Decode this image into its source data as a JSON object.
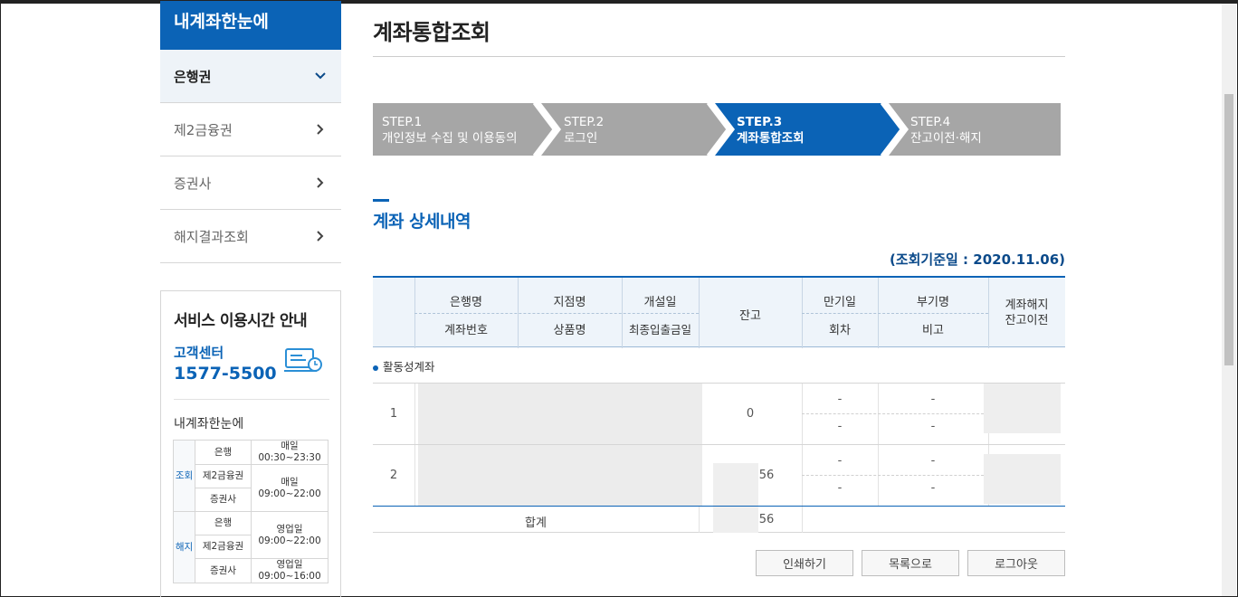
{
  "sidebar": {
    "header": "내계좌한눈에",
    "items": [
      {
        "label": "은행권"
      },
      {
        "label": "제2금융권"
      },
      {
        "label": "증권사"
      },
      {
        "label": "해지결과조회"
      }
    ]
  },
  "service": {
    "title": "서비스 이용시간 안내",
    "center_label": "고객센터",
    "center_number": "1577-5500",
    "subtitle": "내계좌한눈에",
    "groups": [
      {
        "name": "조회",
        "rows": [
          {
            "kind": "은행",
            "time": "매일\n00:30~23:30"
          },
          {
            "kind": "제2금융권",
            "time": "매일\n09:00~22:00"
          },
          {
            "kind": "증권사",
            "time": ""
          }
        ]
      },
      {
        "name": "해지",
        "rows": [
          {
            "kind": "은행",
            "time": "영업일\n09:00~22:00"
          },
          {
            "kind": "제2금융권",
            "time": ""
          },
          {
            "kind": "증권사",
            "time": "영업일\n09:00~16:00"
          }
        ]
      }
    ]
  },
  "main": {
    "title": "계좌통합조회",
    "steps": [
      {
        "num": "STEP.1",
        "label": "개인정보 수집 및 이용동의"
      },
      {
        "num": "STEP.2",
        "label": "로그인"
      },
      {
        "num": "STEP.3",
        "label": "계좌통합조회"
      },
      {
        "num": "STEP.4",
        "label": "잔고이전·해지"
      }
    ],
    "section_title": "계좌 상세내역",
    "date_line": "(조회기준일 : 2020.11.06)",
    "table": {
      "h_bank": "은행명",
      "h_account": "계좌번호",
      "h_branch": "지점명",
      "h_product": "상품명",
      "h_open": "개설일",
      "h_last": "최종입출금일",
      "h_balance": "잔고",
      "h_maturity": "만기일",
      "h_round": "회차",
      "h_sub": "부기명",
      "h_note": "비고",
      "h_close": "계좌해지\n잔고이전"
    },
    "active_label": "활동성계좌",
    "rows": [
      {
        "no": "1",
        "balance": "0",
        "maturity": "-",
        "round": "-",
        "sub": "-",
        "note": "-"
      },
      {
        "no": "2",
        "balance": "56",
        "maturity": "-",
        "round": "-",
        "sub": "-",
        "note": "-"
      }
    ],
    "sum_label": "합계",
    "sum_value": "56",
    "buttons": {
      "print": "인쇄하기",
      "list": "목록으로",
      "logout": "로그아웃"
    }
  },
  "colors": {
    "accent": "#0b63b6",
    "step_inactive": "#a6a6a6"
  }
}
